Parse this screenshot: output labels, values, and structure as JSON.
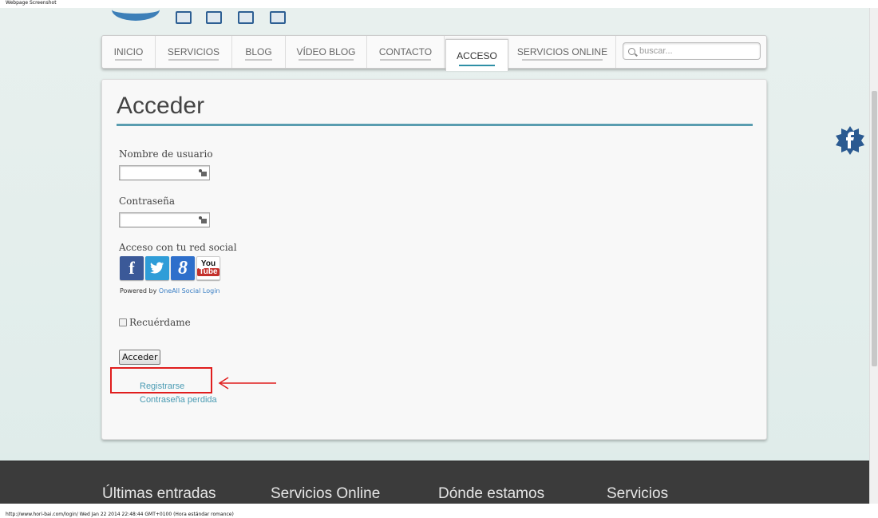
{
  "caption": "Webpage Screenshot",
  "status_line": "http://www.hori-bai.com/login/ Wed Jan 22 2014 22:48:44 GMT+0100 (Hora estándar romance)",
  "nav": {
    "items": [
      "INICIO",
      "SERVICIOS",
      "BLOG",
      "VÍDEO BLOG",
      "CONTACTO",
      "ACCESO",
      "SERVICIOS ONLINE"
    ],
    "active": "ACCESO",
    "search_placeholder": "buscar..."
  },
  "login": {
    "title": "Acceder",
    "username_label": "Nombre de usuario",
    "password_label": "Contraseña",
    "social_label": "Acceso con tu red social",
    "social_icons": [
      "facebook-icon",
      "twitter-icon",
      "google-icon",
      "youtube-icon"
    ],
    "powered_prefix": "Powered by ",
    "powered_link": "OneAll Social Login",
    "remember_label": "Recuérdame",
    "submit_label": "Acceder",
    "register_link": "Registrarse",
    "lost_password_link": "Contraseña perdida"
  },
  "social_glyphs": {
    "facebook": "f",
    "twitter": "t",
    "google": "8",
    "youtube_top": "You",
    "youtube_bottom": "Tube"
  },
  "footer": {
    "headings": [
      "Últimas entradas",
      "Servicios Online",
      "Dónde estamos",
      "Servicios"
    ]
  },
  "colors": {
    "accent": "#5a9db0",
    "link": "#4a9bb3",
    "highlight": "#e01e1e",
    "footer_bg": "#3b3b3b"
  }
}
